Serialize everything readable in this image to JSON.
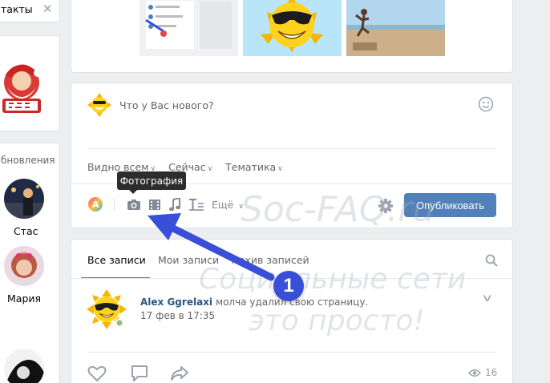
{
  "left": {
    "top_label": "такты",
    "friends_title": "бновления",
    "friends": [
      {
        "name": "Стас"
      },
      {
        "name": "Мария"
      }
    ]
  },
  "composer": {
    "placeholder": "Что у Вас нового?",
    "visibility": "Видно всем",
    "time": "Сейчас",
    "topic": "Тематика",
    "more": "Ещё",
    "publish": "Опубликовать",
    "tooltip": "Фотография"
  },
  "feed": {
    "tabs": [
      "Все записи",
      "Мои записи",
      "Архив записей"
    ],
    "post": {
      "author": "Alex Ggrelaxi",
      "action": "молча удалил свою страницу.",
      "date": "17 фев в 17:35",
      "views": "16"
    }
  },
  "watermark": {
    "brand": "Soc-FAQ.ru",
    "line1": "Социальные сети",
    "line2": "это просто!"
  },
  "annotation": {
    "step": "1"
  },
  "colors": {
    "accent": "#5181b8",
    "link": "#2a5885",
    "arrow": "#3a4fd8"
  }
}
